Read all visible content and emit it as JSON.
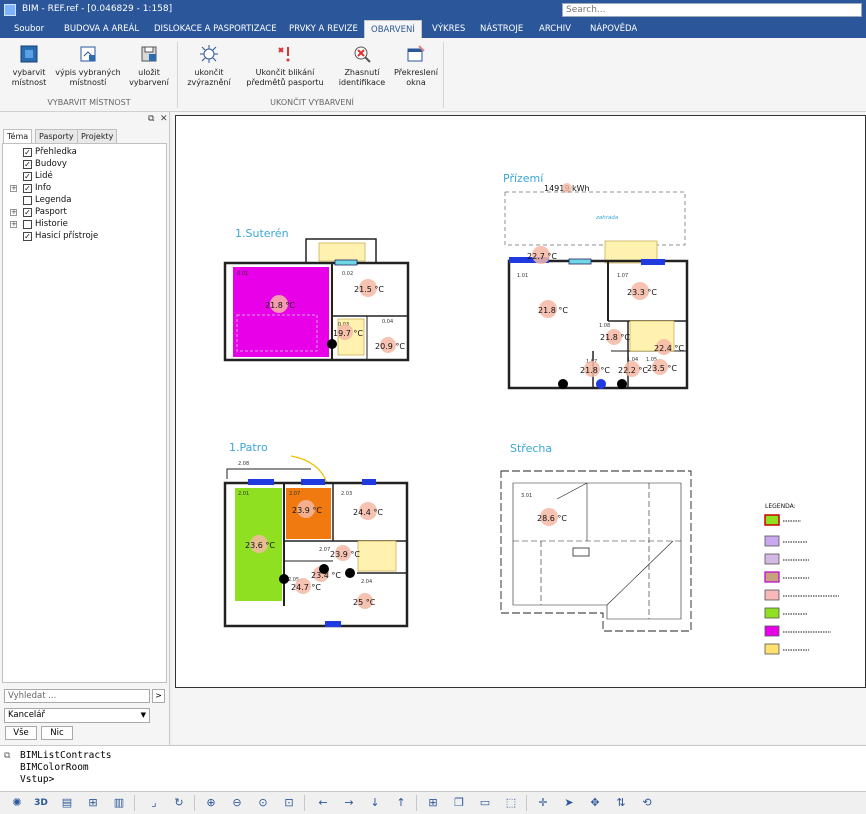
{
  "titlebar": {
    "title": "BIM - REF.ref - [0.046829 - 1:158]",
    "search_placeholder": "Search..."
  },
  "menu": [
    "Soubor",
    "BUDOVA A AREÁL",
    "DISLOKACE A PASPORTIZACE",
    "PRVKY A REVIZE",
    "OBARVENÍ",
    "VÝKRES",
    "NÁSTROJE",
    "ARCHIV",
    "NÁPOVĚDA"
  ],
  "menu_active": "OBARVENÍ",
  "ribbon": {
    "buttons": [
      {
        "l1": "vybarvit",
        "l2": "místnost"
      },
      {
        "l1": "výpis vybraných",
        "l2": "místností"
      },
      {
        "l1": "uložit",
        "l2": "vybarvení"
      },
      {
        "l1": "ukončit",
        "l2": "zvýraznění"
      },
      {
        "l1": "Ukončit blikání",
        "l2": "předmětů pasportu"
      },
      {
        "l1": "Zhasnutí",
        "l2": "identifikace"
      },
      {
        "l1": "Překreslení",
        "l2": "okna"
      }
    ],
    "groups": [
      "VYBARVIT MÍSTNOST",
      "UKONČIT VYBARVENÍ"
    ]
  },
  "panel": {
    "tabs": [
      "Téma",
      "Pasporty",
      "Projekty"
    ],
    "tree": [
      {
        "label": "Přehledka",
        "checked": true,
        "expandable": false
      },
      {
        "label": "Budovy",
        "checked": true,
        "expandable": false
      },
      {
        "label": "Lidé",
        "checked": true,
        "expandable": false
      },
      {
        "label": "Info",
        "checked": true,
        "expandable": true
      },
      {
        "label": "Legenda",
        "checked": false,
        "expandable": false
      },
      {
        "label": "Pasport",
        "checked": true,
        "expandable": true
      },
      {
        "label": "Historie",
        "checked": false,
        "expandable": true
      },
      {
        "label": "Hasicí přístroje",
        "checked": true,
        "expandable": false
      }
    ],
    "filter_placeholder": "Vyhledat ...",
    "filter_go": ">",
    "category": "Kancelář",
    "btn_all": "Vše",
    "btn_none": "Nic"
  },
  "drawing": {
    "floors": {
      "suteren": "1.Suterén",
      "prizemi": "Přízemí",
      "patro": "1.Patro",
      "strecha": "Střecha"
    },
    "energy": "14919 kWh",
    "zahrada": "zahrada",
    "legend_title": "LEGENDA:",
    "temps": {
      "s1": "21.8 °C",
      "s2": "21.5 °C",
      "s3": "19.7 °C",
      "s4": "20.9 °C",
      "p0": "22.7 °C",
      "p1": "21.8 °C",
      "p2": "23.3 °C",
      "p3": "21.8 °C",
      "p4": "22.4 °C",
      "p5": "21.8 °C",
      "p6": "22.2 °C",
      "p7": "23.5 °C",
      "f1": "23.6 °C",
      "f2": "23.9 °C",
      "f3": "24.4 °C",
      "f4": "23.9 °C",
      "f5": "23.4 °C",
      "f6": "24.7 °C",
      "f7": "25 °C",
      "r1": "28.6 °C"
    },
    "room_nums": {
      "s1": "0.01",
      "s2": "0.02",
      "s3": "0.03",
      "s4": "0.04",
      "p1": "1.01",
      "p2": "1.07",
      "p3": "1.08",
      "p4": "1.07",
      "p5": "1.04",
      "p6": "1.05",
      "f0": "2.08",
      "f1": "2.01",
      "f2": "2.07",
      "f3": "2.03",
      "f4": "2.07",
      "f5": "2.05",
      "f6": "2.04",
      "r1": "3.01"
    }
  },
  "cmdline": [
    "BIMListContracts",
    "BIMColorRoom",
    "Vstup>"
  ],
  "toolbar": {
    "icons": [
      "radar-icon",
      "3d-icon",
      "layers-icon",
      "tree-icon",
      "stack-icon",
      "corner-icon",
      "refresh-icon",
      "zoom-in-icon",
      "zoom-out-icon",
      "zoom-extents-icon",
      "zoom-window-icon",
      "arrow-left-icon",
      "arrow-right-icon",
      "arrow-down-icon",
      "arrow-up-icon",
      "grid-icon",
      "copy-icon",
      "rect-icon",
      "select-icon",
      "crosshair-icon",
      "cursor-icon",
      "move-icon",
      "axis-icon",
      "rotate-icon"
    ],
    "label_3d": "3D"
  }
}
